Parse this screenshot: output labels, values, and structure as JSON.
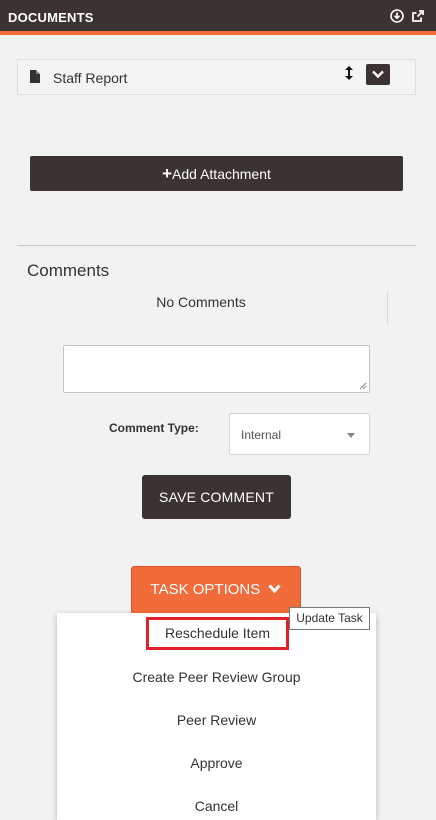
{
  "header": {
    "title": "DOCUMENTS",
    "icons": [
      "download-icon",
      "external-link-icon"
    ]
  },
  "document": {
    "name": "Staff Report",
    "icons": [
      "file-icon",
      "sort-icon",
      "chevron-down-icon"
    ]
  },
  "add_attachment": {
    "plus": "+",
    "label": "Add Attachment"
  },
  "comments": {
    "title": "Comments",
    "empty_text": "No Comments",
    "input_value": "",
    "type_label": "Comment Type:",
    "type_value": "Internal",
    "save_label": "SAVE COMMENT"
  },
  "task_options": {
    "label": "TASK OPTIONS",
    "tooltip": "Update Task",
    "items": [
      "Reschedule Item",
      "Create Peer Review Group",
      "Peer Review",
      "Approve",
      "Cancel"
    ],
    "highlighted_item": "Reschedule Item",
    "colors": {
      "accent": "#f26b3a",
      "dark": "#3b3232",
      "highlight_border": "#e0202a"
    }
  }
}
